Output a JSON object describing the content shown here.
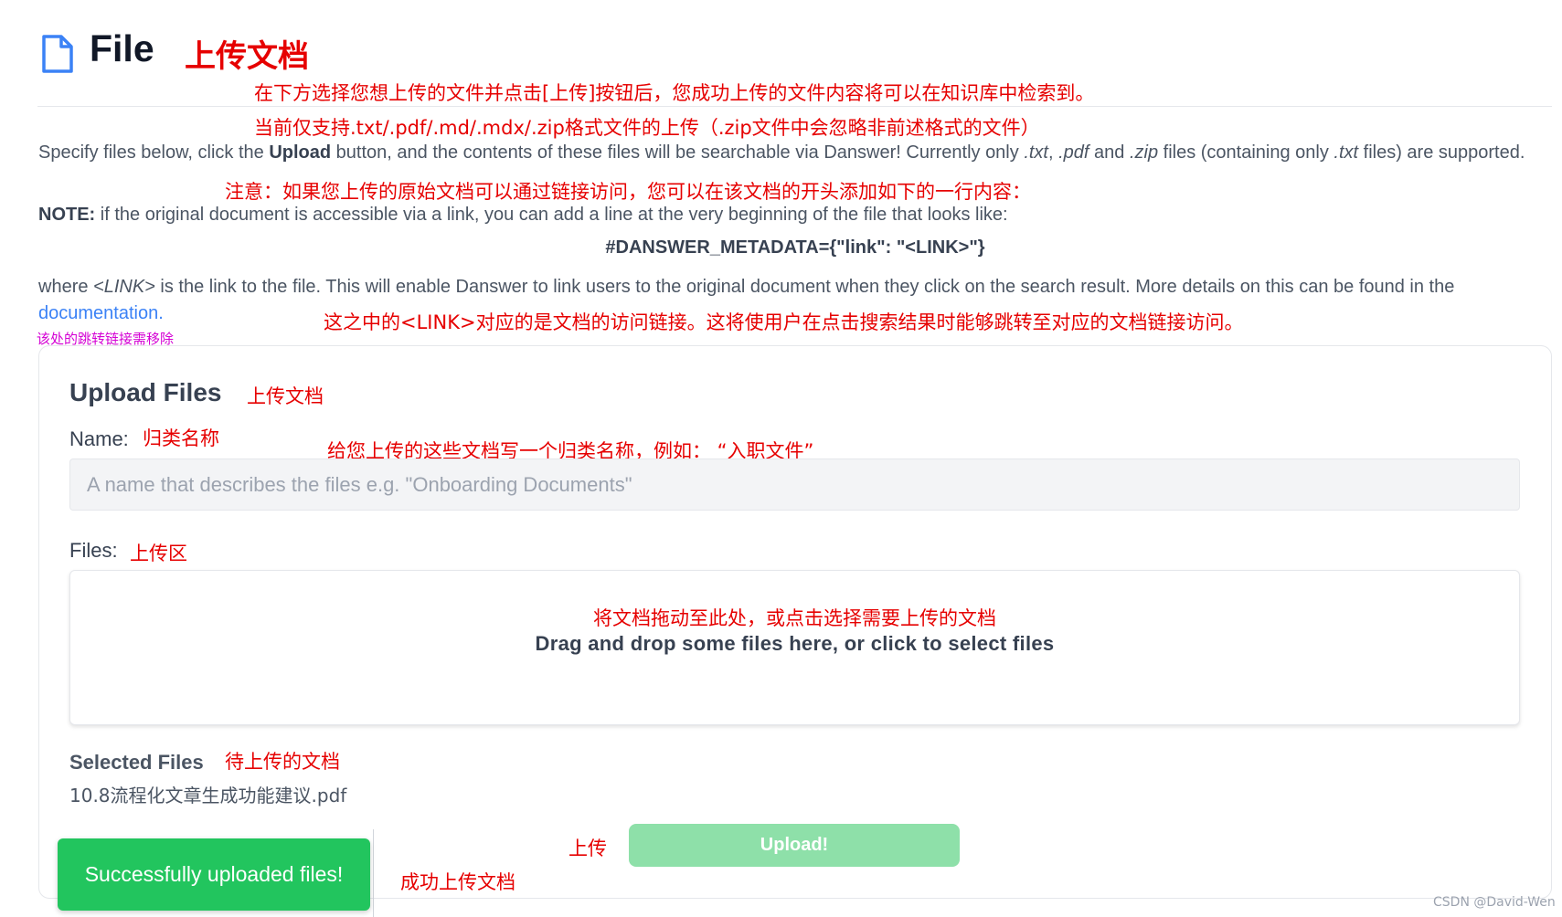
{
  "header": {
    "title": "File",
    "icon": "file-icon",
    "annotation": "上传文档"
  },
  "annotations": {
    "intro_line1": "在下方选择您想上传的文件并点击[上传]按钮后，您成功上传的文件内容将可以在知识库中检索到。",
    "intro_line2": "当前仅支持.txt/.pdf/.md/.mdx/.zip格式文件的上传（.zip文件中会忽略非前述格式的文件）",
    "note": "注意：如果您上传的原始文档可以通过链接访问，您可以在该文档的开头添加如下的一行内容：",
    "link_explain": "这之中的<LINK>对应的是文档的访问链接。这将使用户在点击搜索结果时能够跳转至对应的文档链接访问。",
    "remove_link": "该处的跳转链接需移除",
    "card_title": "上传文档",
    "name_label": "归类名称",
    "name_hint": "给您上传的这些文档写一个归类名称，例如：   “入职文件”",
    "files_label": "上传区",
    "dropzone": "将文档拖动至此处，或点击选择需要上传的文档",
    "selected": "待上传的文档",
    "upload": "上传",
    "success": "成功上传文档"
  },
  "description": {
    "p1_a": "Specify files below, click the ",
    "p1_bold": "Upload",
    "p1_b": " button, and the contents of these files will be searchable via Danswer! Currently only ",
    "ext_txt": ".txt",
    "comma1": ", ",
    "ext_pdf": ".pdf",
    "and": " and ",
    "ext_zip": ".zip",
    "p1_c": " files (containing only ",
    "ext_txt2": ".txt",
    "p1_d": " files) are supported.",
    "note_bold": "NOTE:",
    "note_text": " if the original document is accessible via a link, you can add a line at the very beginning of the file that looks like:",
    "metadata": "#DANSWER_METADATA={\"link\": \"<LINK>\"}",
    "where": "where ",
    "link_token": "<LINK>",
    "where_text": " is the link to the file. This will enable Danswer to link users to the original document when they click on the search result. More details on this can be found in the ",
    "doc_link": "documentation."
  },
  "upload_card": {
    "title": "Upload Files",
    "name_label": "Name:",
    "name_placeholder": "A name that describes the files e.g. \"Onboarding Documents\"",
    "files_label": "Files:",
    "dropzone_text": "Drag and drop some files here, or click to select files",
    "selected_title": "Selected Files",
    "selected_files": [
      "10.8流程化文章生成功能建议.pdf"
    ],
    "upload_button": "Upload!"
  },
  "toast": {
    "message": "Successfully uploaded files!"
  },
  "watermark": "CSDN @David-Wen",
  "colors": {
    "annotation_red": "#e60000",
    "annotation_magenta": "#d400d4",
    "toast_green": "#22c55e",
    "upload_disabled_green": "#8ee0a9",
    "icon_blue": "#3b82f6"
  }
}
